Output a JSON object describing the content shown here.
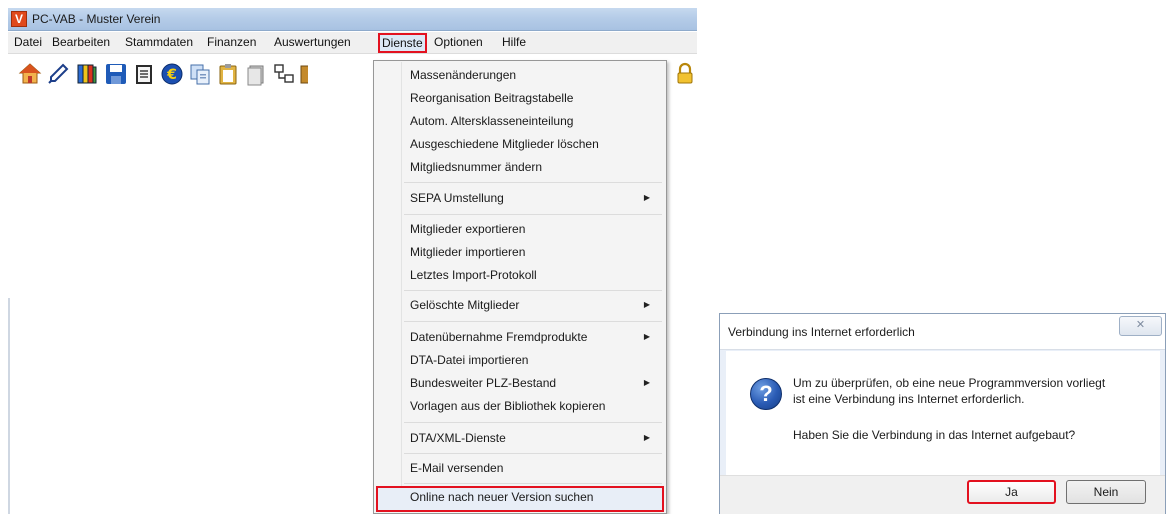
{
  "app": {
    "title": "PC-VAB  -  Muster Verein",
    "icon_letter": "V"
  },
  "menubar": {
    "items": [
      {
        "label": "Datei"
      },
      {
        "label": "Bearbeiten"
      },
      {
        "label": "Stammdaten"
      },
      {
        "label": "Finanzen"
      },
      {
        "label": "Auswertungen"
      },
      {
        "label": "Dienste",
        "active": true
      },
      {
        "label": "Optionen"
      },
      {
        "label": "Hilfe"
      }
    ]
  },
  "toolbar": {
    "icons": [
      "house-icon",
      "pen-icon",
      "books-icon",
      "save-icon",
      "notes-icon",
      "euro-icon",
      "copy-icon",
      "clipboard-icon",
      "document-icon",
      "structure-icon",
      "tool-icon",
      "lock-icon"
    ]
  },
  "dropdown": {
    "items": [
      {
        "label": "Massenänderungen"
      },
      {
        "label": "Reorganisation Beitragstabelle"
      },
      {
        "label": "Autom. Altersklasseneinteilung"
      },
      {
        "label": "Ausgeschiedene Mitglieder löschen"
      },
      {
        "label": "Mitgliedsnummer ändern"
      },
      {
        "label": "SEPA Umstellung",
        "submenu": true
      },
      {
        "label": "Mitglieder exportieren"
      },
      {
        "label": "Mitglieder importieren"
      },
      {
        "label": "Letztes Import-Protokoll"
      },
      {
        "label": "Gelöschte Mitglieder",
        "submenu": true
      },
      {
        "label": "Datenübernahme Fremdprodukte",
        "submenu": true
      },
      {
        "label": "DTA-Datei importieren"
      },
      {
        "label": "Bundesweiter PLZ-Bestand",
        "submenu": true
      },
      {
        "label": "Vorlagen aus der Bibliothek kopieren"
      },
      {
        "label": "DTA/XML-Dienste",
        "submenu": true
      },
      {
        "label": "E-Mail versenden"
      },
      {
        "label": "Online nach neuer Version suchen",
        "highlighted": true
      }
    ],
    "submenu_arrow": "▶"
  },
  "dialog": {
    "title": "Verbindung ins Internet erforderlich",
    "close_label": "✕",
    "icon": "question-icon",
    "icon_glyph": "?",
    "message_line1": "Um zu überprüfen, ob eine neue Programmversion vorliegt",
    "message_line2": "ist eine Verbindung ins Internet erforderlich.",
    "question": "Haben Sie die Verbindung in das Internet aufgebaut?",
    "yes_label": "Ja",
    "no_label": "Nein"
  },
  "colors": {
    "highlight_border": "#e3111f",
    "titlebar": "#b5cce8",
    "menu_background": "#f4f4f4"
  }
}
